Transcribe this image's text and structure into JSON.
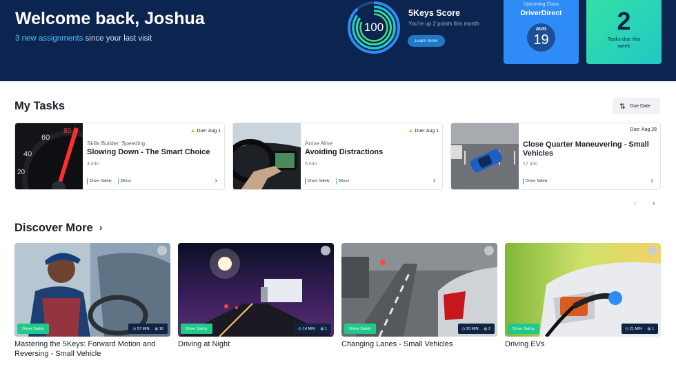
{
  "header": {
    "welcome": "Welcome back, Joshua",
    "assignments_link": "3 new assignments",
    "assignments_suffix": " since your last visit",
    "score_value": "100",
    "score_title": "5Keys Score",
    "score_subtitle": "You're up 2 points this month",
    "learn_more": "Learn more",
    "class_label": "Upcoming Class",
    "class_name": "DriverDirect",
    "class_month": "AUG",
    "class_day": "19",
    "tasks_count": "2",
    "tasks_label": "Tasks due this week"
  },
  "my_tasks": {
    "title": "My Tasks",
    "sort_label": "Due Date",
    "items": [
      {
        "due": "Due: Aug 1",
        "warning": true,
        "category": "Skills Builder: Speeding",
        "title": "Slowing Down - The Smart Choice",
        "duration": "3 min",
        "tags": [
          "Driver Safety",
          "5Keys"
        ]
      },
      {
        "due": "Due: Aug 1",
        "warning": true,
        "category": "Arrive Alive",
        "title": "Avoiding Distractions",
        "duration": "5 min",
        "tags": [
          "Driver Safety",
          "5Keys"
        ]
      },
      {
        "due": "Due: Aug 28",
        "warning": false,
        "category": "",
        "title": "Close Quarter Maneuvering - Small Vehicles",
        "duration": "17 min",
        "tags": [
          "Driver Safety"
        ]
      }
    ]
  },
  "discover": {
    "title": "Discover More",
    "items": [
      {
        "badge": "Driver Safety",
        "duration": "57 MIN",
        "count": "16",
        "title": "Mastering the 5Keys: Forward Motion and Reversing - Small Vehicle"
      },
      {
        "badge": "Driver Safety",
        "duration": "14 MIN",
        "count": "1",
        "title": "Driving at Night"
      },
      {
        "badge": "Driver Safety",
        "duration": "20 MIN",
        "count": "2",
        "title": "Changing Lanes - Small Vehicles"
      },
      {
        "badge": "Driver Safety",
        "duration": "21 MIN",
        "count": "1",
        "title": "Driving EVs"
      }
    ]
  },
  "colors": {
    "header_bg": "#0c2450",
    "accent_blue": "#2f8cf6",
    "accent_green": "#20c98a",
    "warning": "#f5a623"
  }
}
